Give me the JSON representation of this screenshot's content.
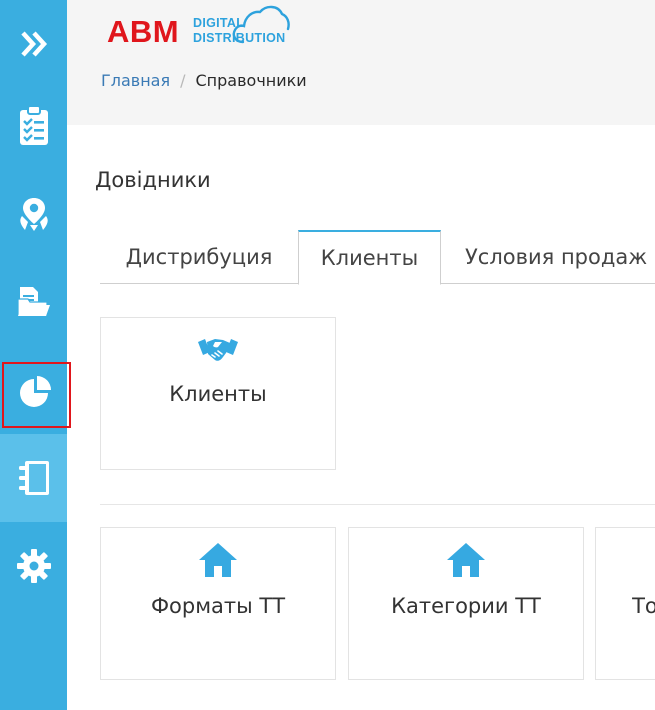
{
  "logo": {
    "brand": "ABM",
    "line1": "DIGITAL",
    "line2": "DISTRIBUTION"
  },
  "breadcrumb": {
    "home": "Главная",
    "separator": "/",
    "current": "Справочники"
  },
  "page": {
    "title": "Довідники"
  },
  "tabs": [
    {
      "label": "Дистрибуция",
      "active": false
    },
    {
      "label": "Клиенты",
      "active": true
    },
    {
      "label": "Условия продаж",
      "active": false
    }
  ],
  "cards_top": [
    {
      "label": "Клиенты",
      "icon": "handshake-icon"
    }
  ],
  "cards_bottom": [
    {
      "label": "Форматы ТТ",
      "icon": "home-icon"
    },
    {
      "label": "Категории ТТ",
      "icon": "home-icon"
    },
    {
      "label": "Торговые сети",
      "icon": "home-icon"
    }
  ],
  "sidebar": {
    "items": [
      {
        "icon": "double-chevron-right-icon",
        "active": false,
        "highlighted": false
      },
      {
        "icon": "clipboard-checklist-icon",
        "active": false,
        "highlighted": false
      },
      {
        "icon": "map-pins-icon",
        "active": false,
        "highlighted": false
      },
      {
        "icon": "documents-folder-icon",
        "active": false,
        "highlighted": false
      },
      {
        "icon": "pie-chart-icon",
        "active": false,
        "highlighted": true
      },
      {
        "icon": "notebook-icon",
        "active": true,
        "highlighted": false
      },
      {
        "icon": "gear-icon",
        "active": false,
        "highlighted": false
      }
    ]
  },
  "colors": {
    "sidebar": "#3aaee0",
    "sidebar_active": "#5bc0ea",
    "brand_red": "#e0161c",
    "brand_blue": "#2da2dd",
    "highlight_border": "#e0161c",
    "card_icon": "#36a9e1"
  }
}
